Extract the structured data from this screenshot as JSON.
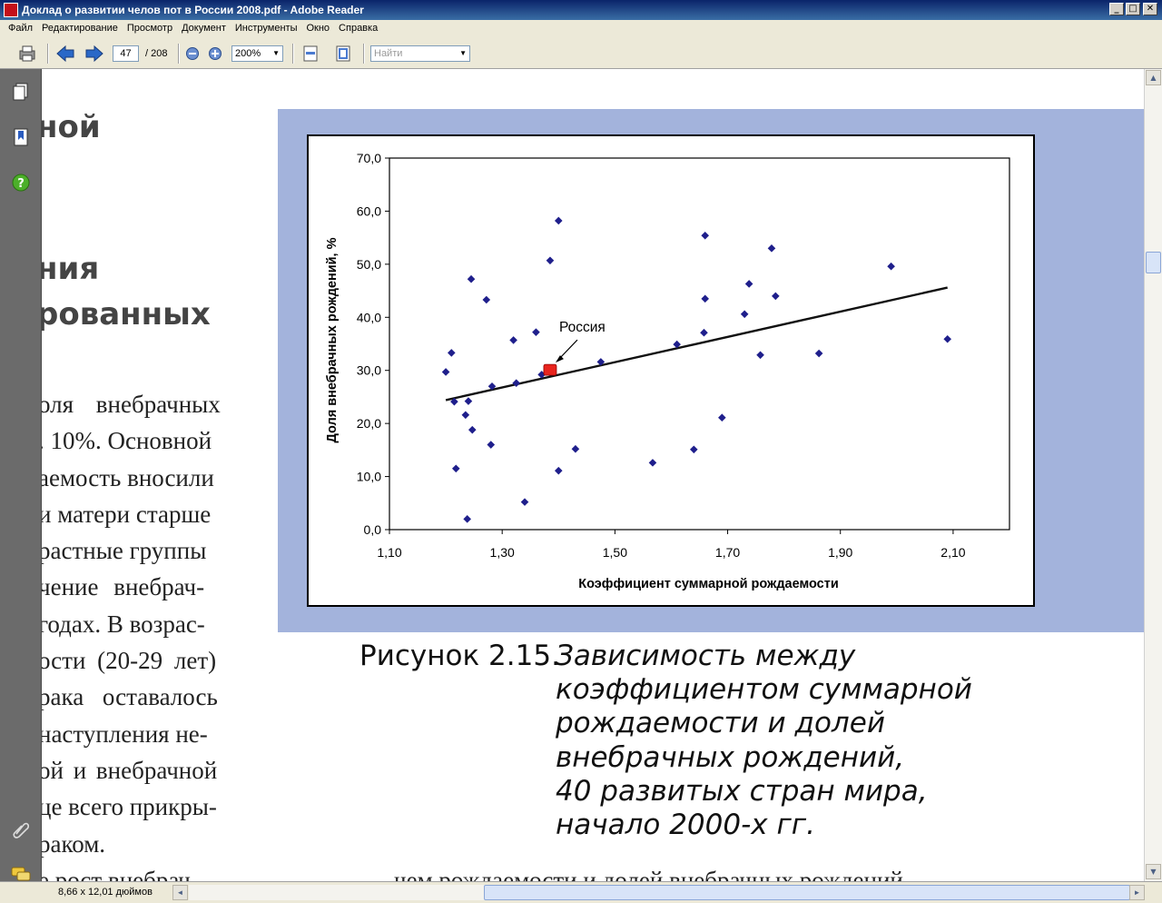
{
  "window": {
    "title": "Доклад о развитии челов пот в России 2008.pdf - Adobe Reader",
    "min": "_",
    "max": "□",
    "close": "✕"
  },
  "menu": [
    "Файл",
    "Редактирование",
    "Просмотр",
    "Документ",
    "Инструменты",
    "Окно",
    "Справка"
  ],
  "toolbar": {
    "page_current": "47",
    "page_total": "/ 208",
    "zoom": "200%",
    "search_placeholder": "Найти"
  },
  "doc": {
    "heading1": "ной",
    "heading2a": "ния",
    "heading2b": "рованных",
    "body_lines": [
      "оля внебрачных",
      ". 10%. Основной",
      "аемость вносили",
      "и матери старше",
      "растные группы",
      "чение внебрач-",
      " годах. В возрас-",
      "ости (20-29 лет)",
      "рака оставалось",
      "наступления не-",
      "ой и внебрачной",
      "це всего прикры-",
      "раком.",
      "е рост внебрач"
    ],
    "bottom_fragment": "чем рождаемости и долей внебрачных рождений",
    "caption_label": "Рисунок 2.15.",
    "caption_lines": [
      "Зависимость между",
      "коэффициентом суммарной",
      "рождаемости и долей",
      "внебрачных рождений,",
      "40 развитых стран мира,",
      "начало 2000-х гг."
    ]
  },
  "status": {
    "page_size": "8,66 x 12,01 дюймов"
  },
  "colors": {
    "panel": "#a3b3dc",
    "point": "#1f1f8c",
    "highlight": "#e8241d"
  },
  "chart_data": {
    "type": "scatter",
    "title": "",
    "xlabel": "Коэффициент суммарной рождаемости",
    "ylabel": "Доля внебрачных рождений, %",
    "xlim": [
      1.1,
      2.2
    ],
    "ylim": [
      0,
      70
    ],
    "xticks": [
      "1,10",
      "1,30",
      "1,50",
      "1,70",
      "1,90",
      "2,10"
    ],
    "xtick_values": [
      1.1,
      1.3,
      1.5,
      1.7,
      1.9,
      2.1
    ],
    "yticks": [
      "0,0",
      "10,0",
      "20,0",
      "30,0",
      "40,0",
      "50,0",
      "60,0",
      "70,0"
    ],
    "ytick_values": [
      0,
      10,
      20,
      30,
      40,
      50,
      60,
      70
    ],
    "grid": true,
    "points": [
      {
        "x": 1.2,
        "y": 29.7
      },
      {
        "x": 1.21,
        "y": 33.3
      },
      {
        "x": 1.215,
        "y": 24.1
      },
      {
        "x": 1.218,
        "y": 11.5
      },
      {
        "x": 1.235,
        "y": 21.6
      },
      {
        "x": 1.238,
        "y": 2.0
      },
      {
        "x": 1.24,
        "y": 24.2
      },
      {
        "x": 1.245,
        "y": 47.2
      },
      {
        "x": 1.247,
        "y": 18.8
      },
      {
        "x": 1.272,
        "y": 43.3
      },
      {
        "x": 1.28,
        "y": 16.0
      },
      {
        "x": 1.282,
        "y": 27.0
      },
      {
        "x": 1.32,
        "y": 35.7
      },
      {
        "x": 1.325,
        "y": 27.6
      },
      {
        "x": 1.34,
        "y": 5.2
      },
      {
        "x": 1.36,
        "y": 37.2
      },
      {
        "x": 1.37,
        "y": 29.2
      },
      {
        "x": 1.385,
        "y": 50.7
      },
      {
        "x": 1.4,
        "y": 58.2
      },
      {
        "x": 1.4,
        "y": 11.1
      },
      {
        "x": 1.43,
        "y": 15.2
      },
      {
        "x": 1.475,
        "y": 31.6
      },
      {
        "x": 1.567,
        "y": 12.6
      },
      {
        "x": 1.61,
        "y": 34.9
      },
      {
        "x": 1.64,
        "y": 15.1
      },
      {
        "x": 1.658,
        "y": 37.1
      },
      {
        "x": 1.66,
        "y": 43.5
      },
      {
        "x": 1.66,
        "y": 55.4
      },
      {
        "x": 1.69,
        "y": 21.1
      },
      {
        "x": 1.73,
        "y": 40.6
      },
      {
        "x": 1.738,
        "y": 46.3
      },
      {
        "x": 1.758,
        "y": 32.9
      },
      {
        "x": 1.778,
        "y": 53.0
      },
      {
        "x": 1.785,
        "y": 44.0
      },
      {
        "x": 1.862,
        "y": 33.2
      },
      {
        "x": 1.99,
        "y": 49.6
      },
      {
        "x": 2.09,
        "y": 35.9
      }
    ],
    "highlight": {
      "x": 1.385,
      "y": 30.1,
      "label": "Россия"
    },
    "trendline": {
      "x": [
        1.2,
        2.09
      ],
      "y": [
        24.4,
        45.6
      ]
    }
  }
}
